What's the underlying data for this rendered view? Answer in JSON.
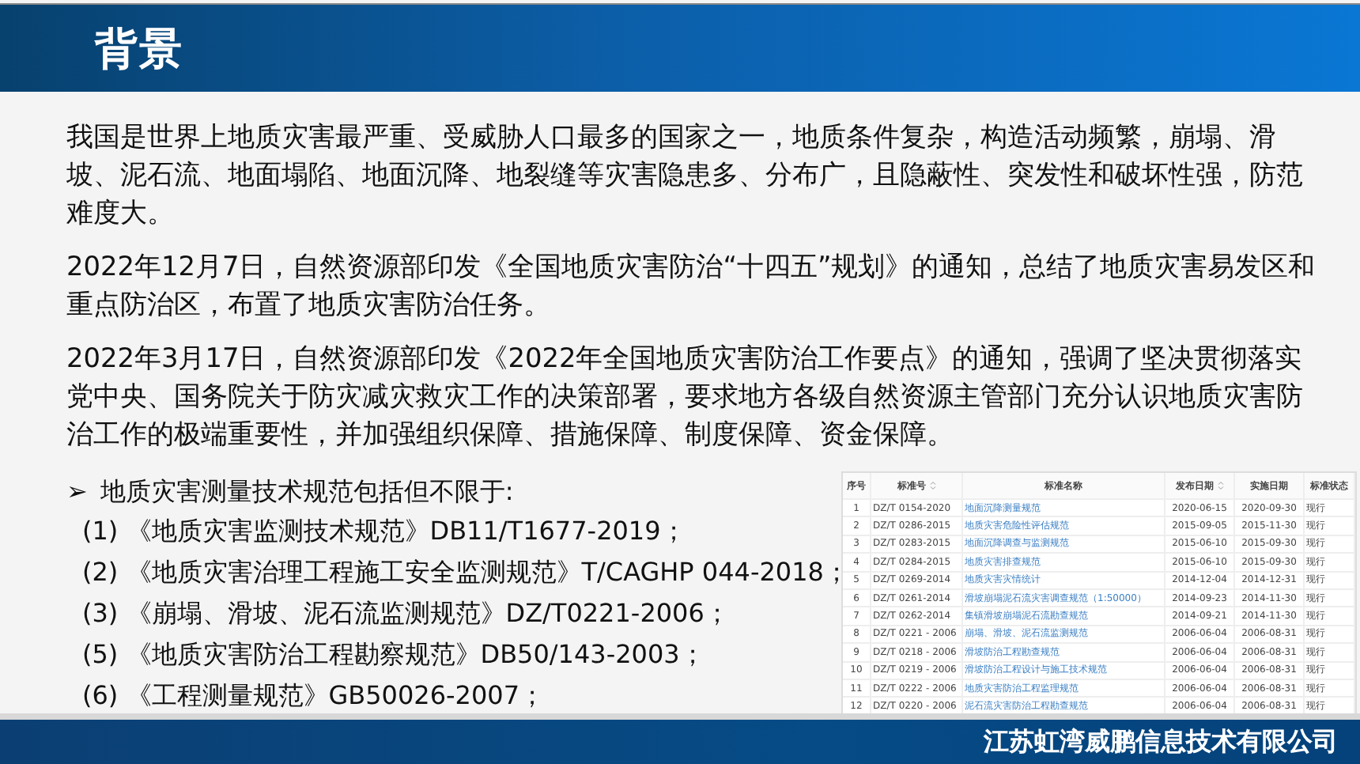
{
  "header": {
    "title": "背景"
  },
  "paragraphs": [
    "我国是世界上地质灾害最严重、受威胁人口最多的国家之一，地质条件复杂，构造活动频繁，崩塌、滑坡、泥石流、地面塌陷、地面沉降、地裂缝等灾害隐患多、分布广，且隐蔽性、突发性和破坏性强，防范难度大。",
    "2022年12月7日，自然资源部印发《全国地质灾害防治“十四五”规划》的通知，总结了地质灾害易发区和重点防治区，布置了地质灾害防治任务。",
    "2022年3月17日，自然资源部印发《2022年全国地质灾害防治工作要点》的通知，强调了坚决贯彻落实党中央、国务院关于防灾减灾救灾工作的决策部署，要求地方各级自然资源主管部门充分认识地质灾害防治工作的极端重要性，并加强组织保障、措施保障、制度保障、资金保障。"
  ],
  "bullet": {
    "marker": "➢",
    "text": "地质灾害测量技术规范包括但不限于:"
  },
  "standards": [
    "(1) 《地质灾害监测技术规范》DB11/T1677-2019；",
    "(2) 《地质灾害治理工程施工安全监测规范》T/CAGHP 044-2018；",
    "(3) 《崩塌、滑坡、泥石流监测规范》DZ/T0221-2006；",
    "(5) 《地质灾害防治工程勘察规范》DB50/143-2003；",
    "(6) 《工程测量规范》GB50026-2007；"
  ],
  "table": {
    "columns": [
      {
        "label": "序号",
        "sortable": false
      },
      {
        "label": "标准号",
        "sortable": true
      },
      {
        "label": "标准名称",
        "sortable": false
      },
      {
        "label": "发布日期",
        "sortable": true
      },
      {
        "label": "实施日期",
        "sortable": false
      },
      {
        "label": "标准状态",
        "sortable": false
      }
    ],
    "rows": [
      [
        "1",
        "DZ/T 0154-2020",
        "地面沉降测量规范",
        "2020-06-15",
        "2020-09-30",
        "现行"
      ],
      [
        "2",
        "DZ/T 0286-2015",
        "地质灾害危险性评估规范",
        "2015-09-05",
        "2015-11-30",
        "现行"
      ],
      [
        "3",
        "DZ/T 0283-2015",
        "地面沉降调查与监测规范",
        "2015-06-10",
        "2015-09-30",
        "现行"
      ],
      [
        "4",
        "DZ/T 0284-2015",
        "地质灾害排查规范",
        "2015-06-10",
        "2015-09-30",
        "现行"
      ],
      [
        "5",
        "DZ/T 0269-2014",
        "地质灾害灾情统计",
        "2014-12-04",
        "2014-12-31",
        "现行"
      ],
      [
        "6",
        "DZ/T 0261-2014",
        "滑坡崩塌泥石流灾害调查规范（1:50000）",
        "2014-09-23",
        "2014-11-30",
        "现行"
      ],
      [
        "7",
        "DZ/T 0262-2014",
        "集镇滑坡崩塌泥石流勘查规范",
        "2014-09-21",
        "2014-11-30",
        "现行"
      ],
      [
        "8",
        "DZ/T 0221 - 2006",
        "崩塌、滑坡、泥石流监测规范",
        "2006-06-04",
        "2006-08-31",
        "现行"
      ],
      [
        "9",
        "DZ/T 0218 - 2006",
        "滑坡防治工程勘查规范",
        "2006-06-04",
        "2006-08-31",
        "现行"
      ],
      [
        "10",
        "DZ/T 0219 - 2006",
        "滑坡防治工程设计与施工技术规范",
        "2006-06-04",
        "2006-08-31",
        "现行"
      ],
      [
        "11",
        "DZ/T 0222 - 2006",
        "地质灾害防治工程监理规范",
        "2006-06-04",
        "2006-08-31",
        "现行"
      ],
      [
        "12",
        "DZ/T 0220 - 2006",
        "泥石流灾害防治工程勘查规范",
        "2006-06-04",
        "2006-08-31",
        "现行"
      ]
    ]
  },
  "footer": {
    "company": "江苏虹湾威鹏信息技术有限公司"
  }
}
